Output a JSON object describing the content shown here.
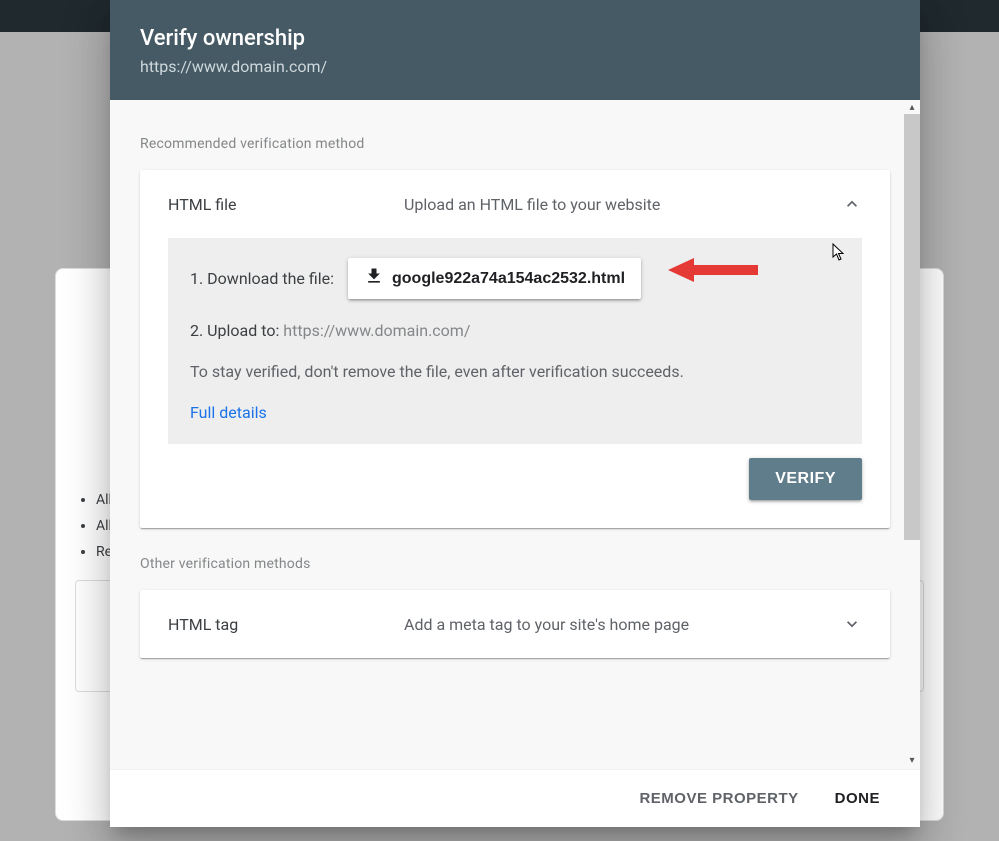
{
  "background": {
    "list_items": [
      "All",
      "All",
      "Re"
    ]
  },
  "modal": {
    "title": "Verify ownership",
    "subtitle": "https://www.domain.com/",
    "recommended_label": "Recommended verification method",
    "other_label": "Other verification methods",
    "html_file": {
      "title": "HTML file",
      "desc": "Upload an HTML file to your website",
      "step1_label": "1. Download the file:",
      "file_name": "google922a74a154ac2532.html",
      "step2_prefix": "2. Upload to: ",
      "step2_url": "https://www.domain.com/",
      "note": "To stay verified, don't remove the file, even after verification succeeds.",
      "full_details": "Full details",
      "verify": "VERIFY"
    },
    "html_tag": {
      "title": "HTML tag",
      "desc": "Add a meta tag to your site's home page"
    },
    "footer": {
      "remove": "REMOVE PROPERTY",
      "done": "DONE"
    }
  }
}
